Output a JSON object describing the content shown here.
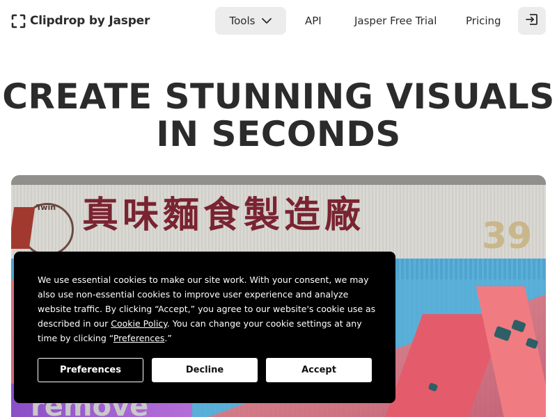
{
  "header": {
    "brand": "Clipdrop by Jasper",
    "nav": {
      "tools_label": "Tools",
      "api_label": "API",
      "trial_label": "Jasper Free Trial",
      "pricing_label": "Pricing"
    },
    "icons": {
      "logo": "clipdrop-logo-icon",
      "tools_chevron": "chevron-down-icon",
      "login": "sign-in-icon"
    }
  },
  "hero": {
    "title_line1": "CREATE STUNNING VISUALS",
    "title_line2": "IN SECONDS"
  },
  "hero_image": {
    "sign_text": "真味麵食製造廠",
    "sign_number": "39",
    "seal_text": "Twin",
    "overlay_text": "remove"
  },
  "cookie_banner": {
    "text_part1": "We use essential cookies to make our site work. With your consent, we may also use non-essential cookies to improve user experience and analyze website traffic. By clicking “Accept,” you agree to our website's cookie use as described in our ",
    "cookie_policy_link": "Cookie Policy",
    "text_part2": ". You can change your cookie settings at any time by clicking “",
    "preferences_link": "Preferences",
    "text_part3": ".”",
    "preferences_button": "Preferences",
    "decline_button": "Decline",
    "accept_button": "Accept"
  },
  "colors": {
    "text_dark": "#2b2b2b",
    "nav_pill_bg": "#ececec",
    "banner_bg": "#000000",
    "button_light": "#ffffff"
  }
}
